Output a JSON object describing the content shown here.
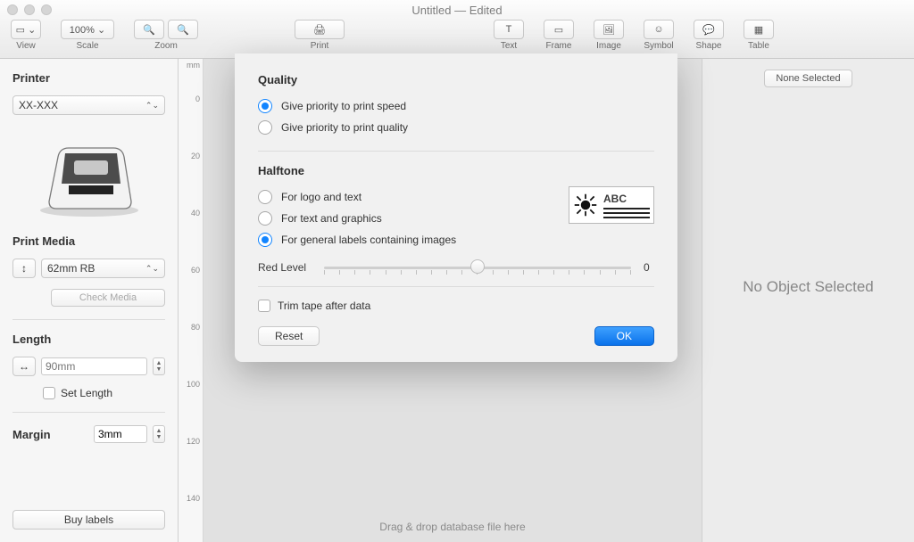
{
  "window": {
    "title": "Untitled — Edited"
  },
  "toolbar": {
    "view_label": "View",
    "scale_value": "100% ⌄",
    "scale_label": "Scale",
    "zoom_label": "Zoom",
    "print_label": "Print",
    "text_label": "Text",
    "frame_label": "Frame",
    "image_label": "Image",
    "symbol_label": "Symbol",
    "shape_label": "Shape",
    "table_label": "Table"
  },
  "sidebar": {
    "printer_header": "Printer",
    "printer_value": "XX-XXX",
    "print_media_header": "Print Media",
    "media_value": "62mm RB",
    "check_media": "Check Media",
    "length_header": "Length",
    "length_placeholder": "90mm",
    "set_length": "Set Length",
    "margin_label": "Margin",
    "margin_value": "3mm",
    "buy_labels": "Buy labels"
  },
  "ruler": {
    "unit": "mm",
    "ticks": [
      "0",
      "20",
      "40",
      "60",
      "80",
      "100",
      "120",
      "140"
    ]
  },
  "canvas": {
    "drag_hint": "Drag & drop database file here"
  },
  "inspector": {
    "none_selected_btn": "None Selected",
    "no_object": "No Object Selected"
  },
  "modal": {
    "quality_header": "Quality",
    "q_speed": "Give priority to print speed",
    "q_quality": "Give priority to print quality",
    "halftone_header": "Halftone",
    "h_logo": "For logo and text",
    "h_textgraphics": "For text and graphics",
    "h_general": "For general labels containing images",
    "preview_text": "ABC",
    "red_level_label": "Red Level",
    "red_level_value": "0",
    "trim_label": "Trim tape after data",
    "reset": "Reset",
    "ok": "OK"
  }
}
